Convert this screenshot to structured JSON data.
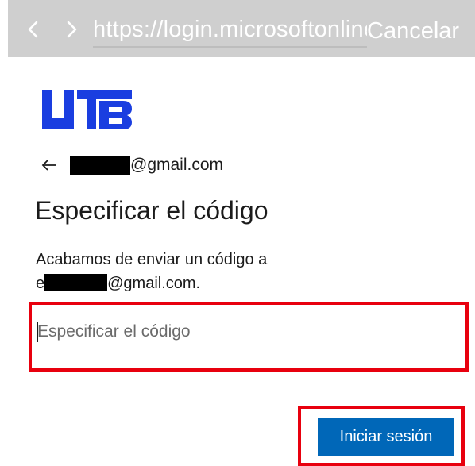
{
  "browser": {
    "url": "https://login.microsoftonline.com",
    "cancel_label": "Cancelar",
    "back_icon": "chevron-left-icon",
    "forward_icon": "chevron-right-icon"
  },
  "logo": {
    "name": "utb-logo",
    "color": "#1a3ee0"
  },
  "identity": {
    "back_icon": "arrow-left-icon",
    "email_suffix": "@gmail.com"
  },
  "page": {
    "title": "Especificar el código",
    "description_line1": "Acabamos de enviar un código a",
    "description_prefix": "e",
    "description_suffix": "@gmail.com."
  },
  "code_input": {
    "placeholder": "Especificar el código",
    "value": ""
  },
  "signin_button": {
    "label": "Iniciar sesión"
  },
  "colors": {
    "accent": "#0067b8",
    "highlight": "#e8000e",
    "toolbar": "#cfcfcf"
  }
}
